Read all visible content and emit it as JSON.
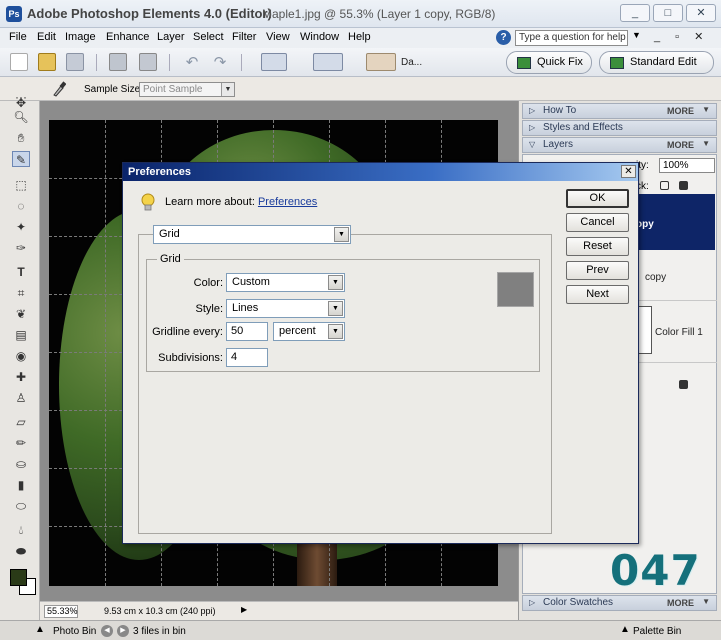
{
  "window": {
    "title": "Adobe Photoshop Elements 4.0 (Editor)",
    "document": "Maple1.jpg @ 55.3% (Layer 1 copy, RGB/8)",
    "controls": [
      "_",
      "□",
      "✕"
    ]
  },
  "menu": [
    "File",
    "Edit",
    "Image",
    "Enhance",
    "Layer",
    "Select",
    "Filter",
    "View",
    "Window",
    "Help"
  ],
  "help_search": {
    "placeholder": "Type a question for help"
  },
  "toolbar": {
    "date_view_label": "Da...",
    "quick_fix": "Quick Fix",
    "standard_edit": "Standard Edit"
  },
  "options": {
    "sample_size_label": "Sample Size:",
    "sample_size_value": "Point Sample"
  },
  "status": {
    "zoom": "55.33%",
    "doc_size": "9.53 cm x 10.3 cm (240 ppi)"
  },
  "bin": {
    "photo_bin": "Photo Bin",
    "files_in_bin": "3 files in bin",
    "palette_bin": "Palette Bin"
  },
  "palettes": {
    "how_to": "How To",
    "styles_effects": "Styles and Effects",
    "layers": "Layers",
    "more": "MORE",
    "color_swatches": "Color Swatches",
    "opacity_label": "ity:",
    "opacity_value": "100%",
    "lock_label": "ck:",
    "layer_selected_text": "opy",
    "layer_copy_text": "copy",
    "color_fill_text": "Color Fill 1"
  },
  "watermark": "047",
  "preferences": {
    "title": "Preferences",
    "learn_more": "Learn more about:",
    "learn_link": "Preferences",
    "category": "Grid",
    "group_title": "Grid",
    "buttons": {
      "ok": "OK",
      "cancel": "Cancel",
      "reset": "Reset",
      "prev": "Prev",
      "next": "Next"
    },
    "color_label": "Color:",
    "color_value": "Custom",
    "style_label": "Style:",
    "style_value": "Lines",
    "gridline_label": "Gridline every:",
    "gridline_value": "50",
    "gridline_unit": "percent",
    "subdivisions_label": "Subdivisions:",
    "subdivisions_value": "4",
    "grid_color_hex": "#808080"
  }
}
